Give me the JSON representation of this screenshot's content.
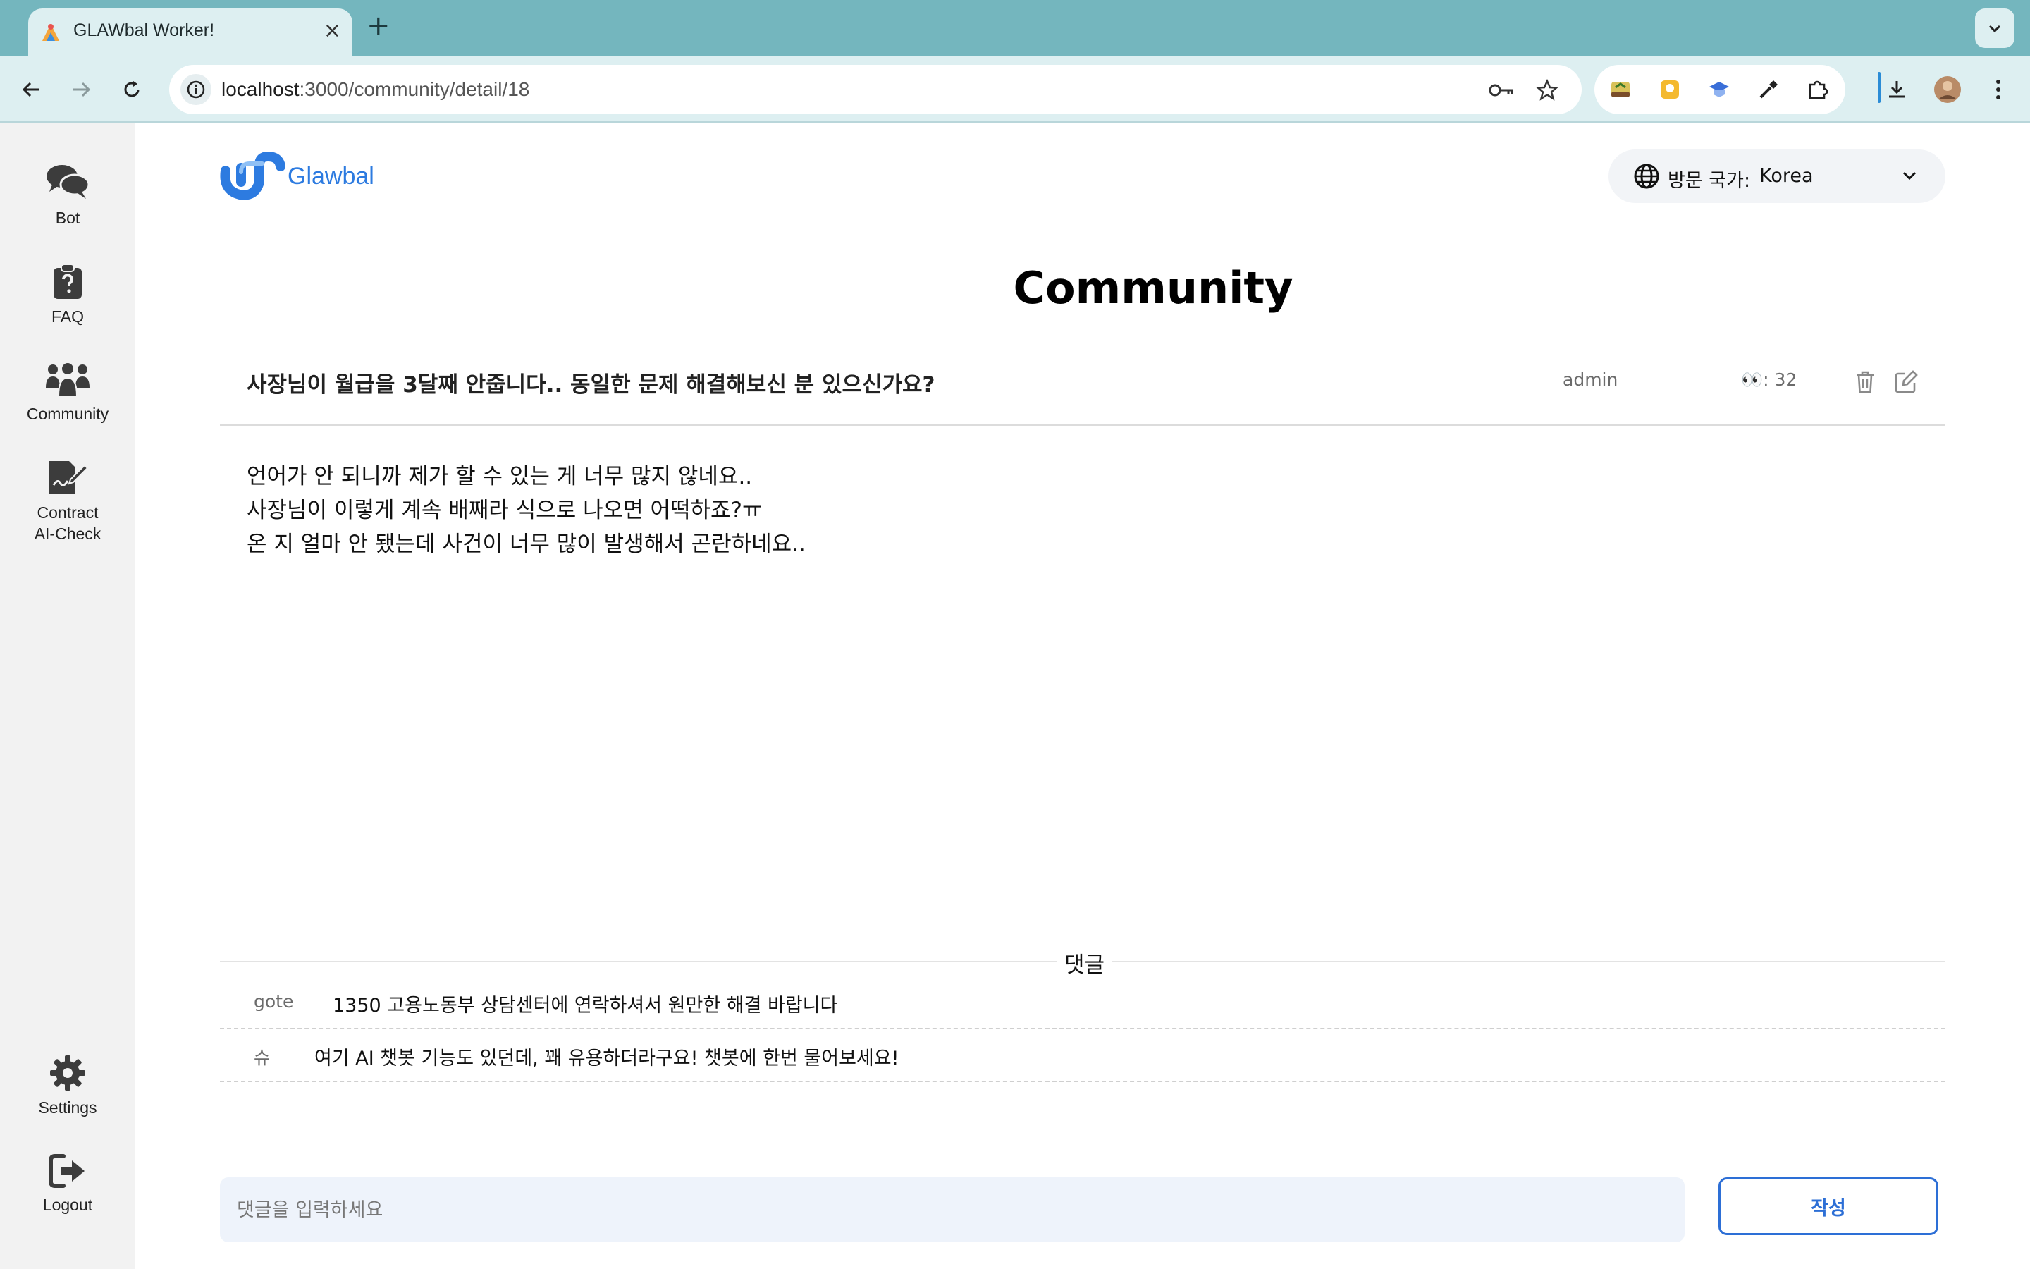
{
  "browser": {
    "tab_title": "GLAWbal Worker!",
    "url_host": "localhost",
    "url_path": ":3000/community/detail/18"
  },
  "sidebar": {
    "items": [
      {
        "label": "Bot",
        "icon": "chat-bubbles-icon"
      },
      {
        "label": "FAQ",
        "icon": "clipboard-question-icon"
      },
      {
        "label": "Community",
        "icon": "people-group-icon"
      },
      {
        "label": "Contract\nAI-Check",
        "icon": "contract-signature-icon"
      }
    ],
    "bottom": [
      {
        "label": "Settings",
        "icon": "gear-icon"
      },
      {
        "label": "Logout",
        "icon": "logout-icon"
      }
    ]
  },
  "header": {
    "logo_text": "Glawbal",
    "country_label": "방문 국가:",
    "country_value": "Korea"
  },
  "page": {
    "title": "Community"
  },
  "post": {
    "title": "사장님이 월급을 3달째 안줍니다.. 동일한 문제 해결해보신 분 있으신가요?",
    "author": "admin",
    "views": "👀: 32",
    "body": [
      "언어가 안 되니까 제가 할 수 있는 게 너무 많지 않네요..",
      "사장님이 이렇게 계속 배째라 식으로 나오면 어떡하죠?ㅠ",
      "온 지 얼마 안 됐는데 사건이 너무 많이 발생해서 곤란하네요.."
    ]
  },
  "comments": {
    "heading": "댓글",
    "items": [
      {
        "author": "gote",
        "text": "1350 고용노동부 상담센터에 연락하셔서 원만한 해결 바랍니다"
      },
      {
        "author": "슈",
        "text": "여기 AI 챗봇 기능도 있던데, 꽤 유용하더라구요! 챗봇에 한번 물어보세요!"
      }
    ],
    "input_placeholder": "댓글을 입력하세요",
    "submit_label": "작성"
  },
  "colors": {
    "brand": "#2d7be0",
    "submit": "#2d6fd6",
    "tabbar": "#74b6be",
    "toolbar": "#ddeff1"
  }
}
